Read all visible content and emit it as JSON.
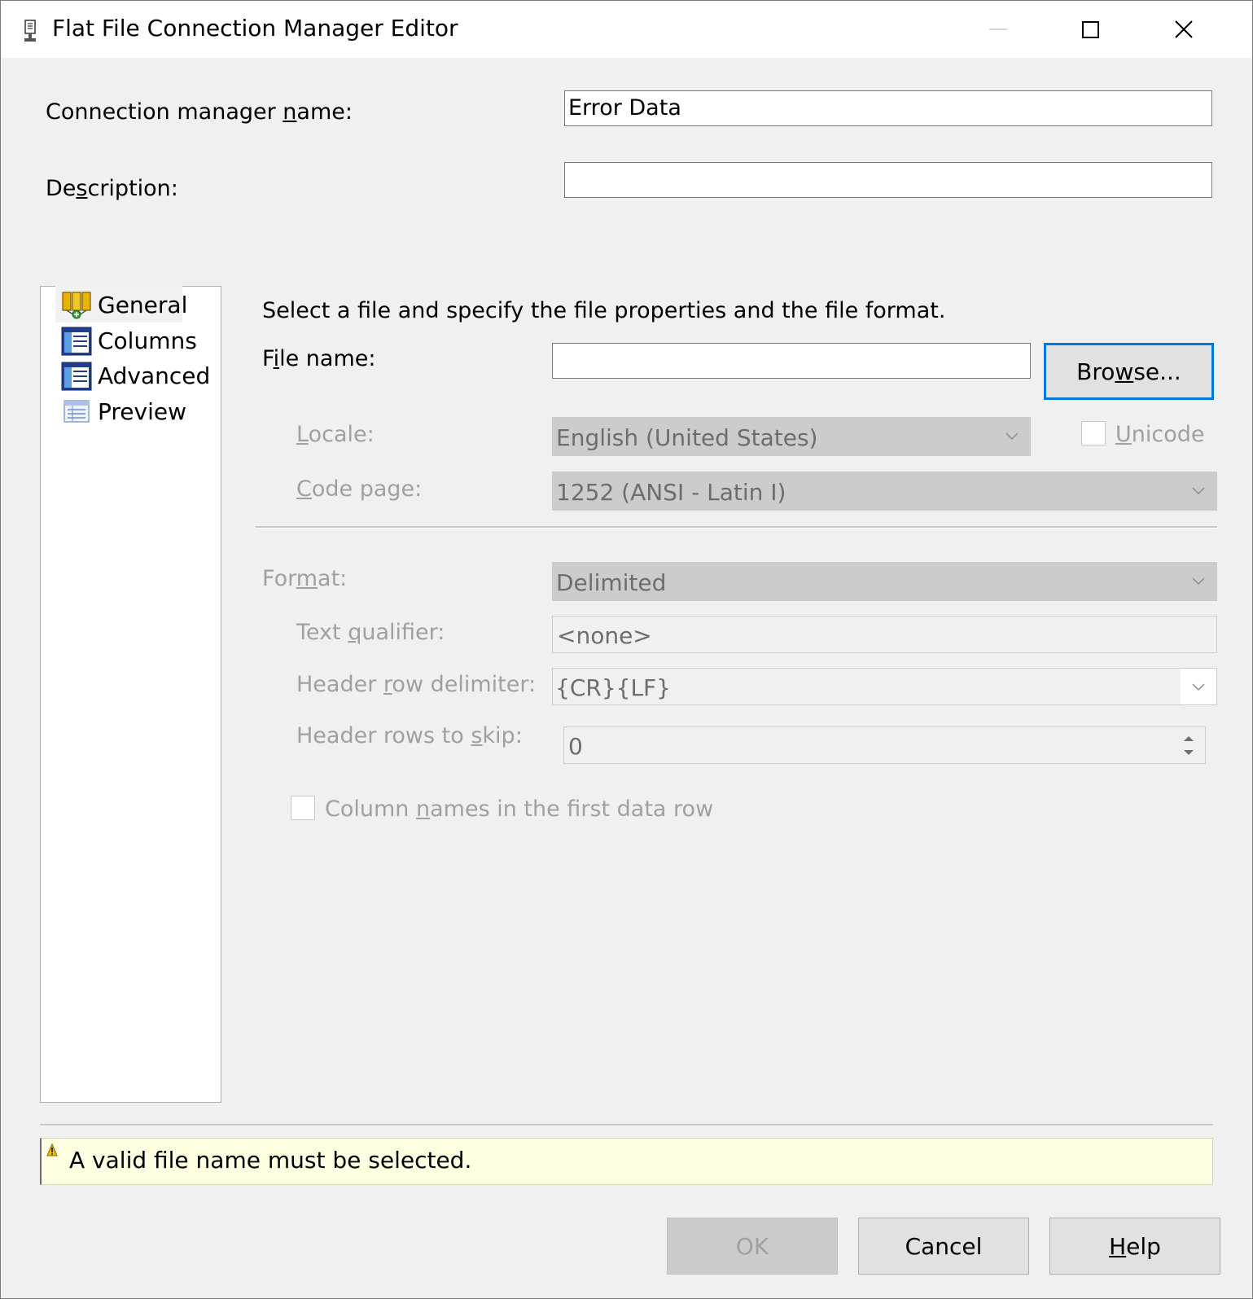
{
  "window": {
    "title": "Flat File Connection Manager Editor"
  },
  "header": {
    "conn_name_label_pre": "Connection manager ",
    "conn_name_label_u": "n",
    "conn_name_label_post": "ame:",
    "conn_name_value": "Error Data",
    "desc_label_pre": "De",
    "desc_label_u": "s",
    "desc_label_post": "cription:",
    "desc_value": ""
  },
  "nav": {
    "items": [
      {
        "label": "General",
        "icon": "general-icon",
        "selected": true
      },
      {
        "label": "Columns",
        "icon": "columns-icon",
        "selected": false
      },
      {
        "label": "Advanced",
        "icon": "advanced-icon",
        "selected": false
      },
      {
        "label": "Preview",
        "icon": "preview-icon",
        "selected": false
      }
    ]
  },
  "general": {
    "instruction": "Select a file and specify the file properties and the file format.",
    "file_name_label_pre": "F",
    "file_name_label_u": "i",
    "file_name_label_post": "le name:",
    "file_name_value": "",
    "browse_pre": "Bro",
    "browse_u": "w",
    "browse_post": "se...",
    "locale_label_u": "L",
    "locale_label_post": "ocale:",
    "locale_value": "English (United States)",
    "unicode_label_u": "U",
    "unicode_label_post": "nicode",
    "unicode_checked": false,
    "codepage_label_u": "C",
    "codepage_label_post": "ode page:",
    "codepage_value": "1252  (ANSI - Latin I)",
    "format_label_pre": "For",
    "format_label_u": "m",
    "format_label_post": "at:",
    "format_value": "Delimited",
    "text_qualifier_label_pre": "Text ",
    "text_qualifier_label_u": "q",
    "text_qualifier_label_post": "ualifier:",
    "text_qualifier_value": "<none>",
    "header_row_delim_label_pre": "Header ",
    "header_row_delim_label_u": "r",
    "header_row_delim_label_post": "ow delimiter:",
    "header_row_delim_value": "{CR}{LF}",
    "header_rows_skip_label_pre": "Header rows to ",
    "header_rows_skip_label_u": "s",
    "header_rows_skip_label_post": "kip:",
    "header_rows_skip_value": "0",
    "col_names_label_pre": "Column ",
    "col_names_label_u": "n",
    "col_names_label_post": "ames in the first data row",
    "col_names_checked": false
  },
  "status": {
    "message": "A valid file name must be selected."
  },
  "buttons": {
    "ok": "OK",
    "cancel": "Cancel",
    "help_u": "H",
    "help_post": "elp"
  },
  "colors": {
    "status_bg": "#ffffe1",
    "focus_border": "#0078d7",
    "disabled_text": "#a0a0a0"
  }
}
